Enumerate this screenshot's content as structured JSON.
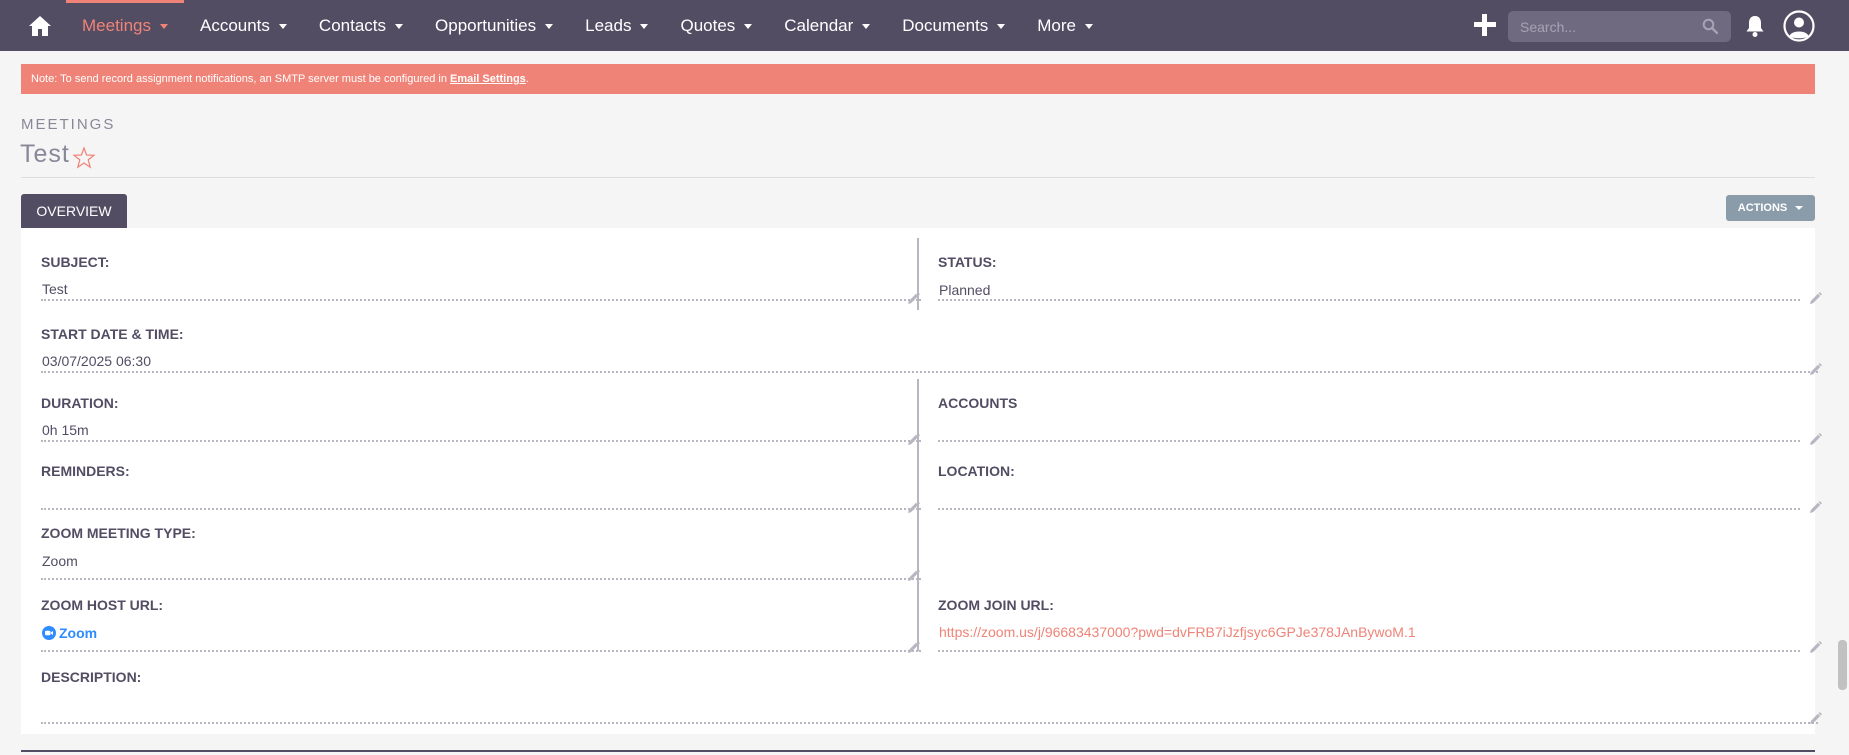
{
  "nav": {
    "items": [
      {
        "label": "Meetings",
        "active": true
      },
      {
        "label": "Accounts"
      },
      {
        "label": "Contacts"
      },
      {
        "label": "Opportunities"
      },
      {
        "label": "Leads"
      },
      {
        "label": "Quotes"
      },
      {
        "label": "Calendar"
      },
      {
        "label": "Documents"
      },
      {
        "label": "More"
      }
    ],
    "search_placeholder": "Search..."
  },
  "alert": {
    "text": "Note: To send record assignment notifications, an SMTP server must be configured in",
    "link": "Email Settings",
    "suffix": "."
  },
  "header": {
    "module": "MEETINGS",
    "title": "Test"
  },
  "tabs": {
    "overview": "OVERVIEW",
    "actions": "ACTIONS"
  },
  "fields": {
    "subject": {
      "label": "SUBJECT:",
      "value": "Test"
    },
    "status": {
      "label": "STATUS:",
      "value": "Planned"
    },
    "start": {
      "label": "START DATE & TIME:",
      "value": "03/07/2025 06:30"
    },
    "duration": {
      "label": "DURATION:",
      "value": "0h 15m"
    },
    "accounts": {
      "label": "ACCOUNTS",
      "value": ""
    },
    "reminders": {
      "label": "REMINDERS:",
      "value": ""
    },
    "location": {
      "label": "LOCATION:",
      "value": ""
    },
    "zoom_type": {
      "label": "ZOOM MEETING TYPE:",
      "value": "Zoom"
    },
    "zoom_host": {
      "label": "ZOOM HOST URL:",
      "value": "Zoom"
    },
    "zoom_join": {
      "label": "ZOOM JOIN URL:",
      "value": "https://zoom.us/j/96683437000?pwd=dvFRB7iJzfjsyc6GPJe378JAnBywoM.1"
    },
    "description": {
      "label": "DESCRIPTION:",
      "value": ""
    }
  },
  "colors": {
    "nav_bg": "#534d64",
    "accent": "#f08377",
    "actions_bg": "#8a9baa"
  }
}
